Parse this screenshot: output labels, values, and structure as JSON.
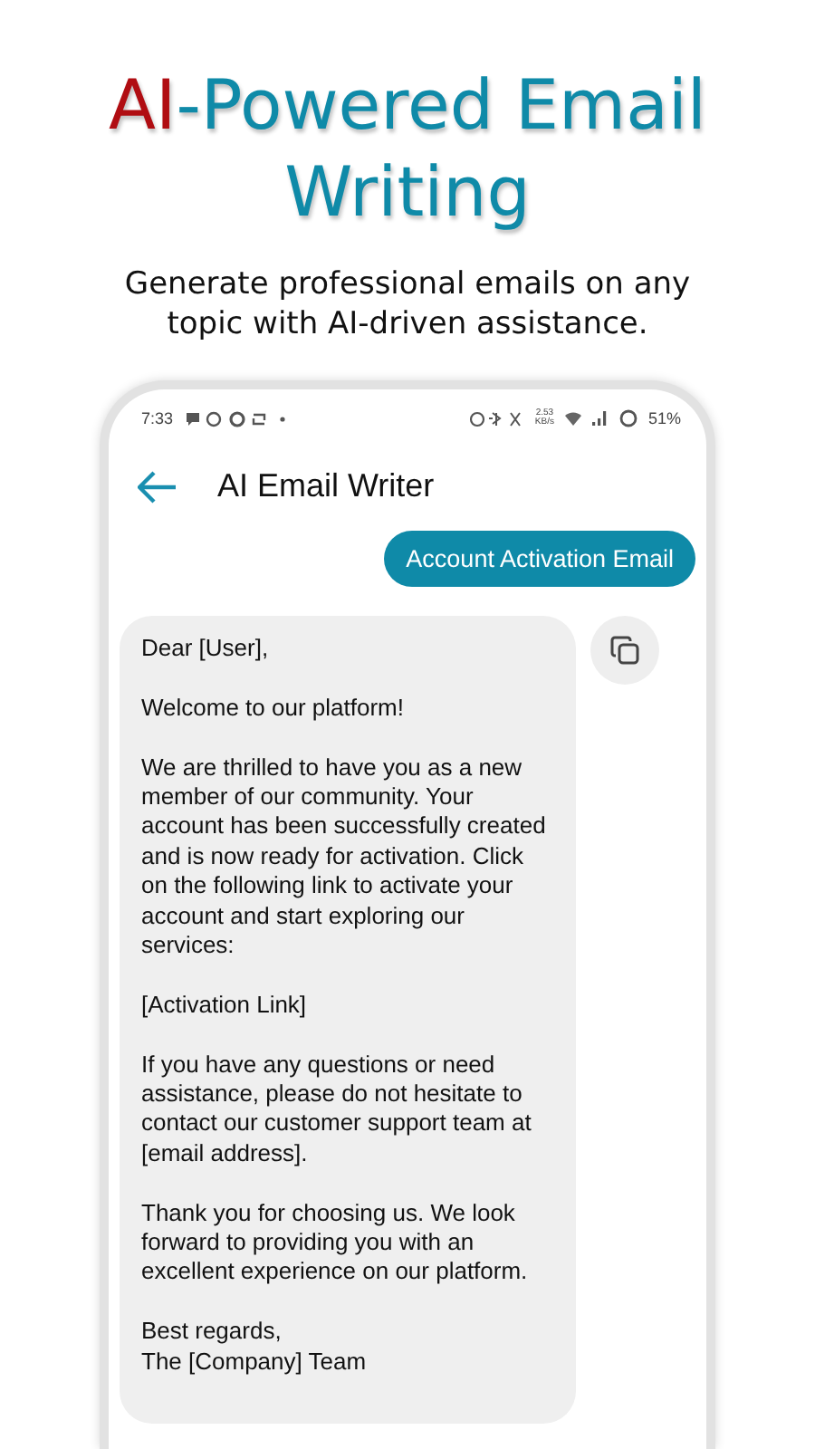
{
  "headline": {
    "accent": "AI",
    "rest": "-Powered Email Writing"
  },
  "subtitle": "Generate professional emails on any topic with AI-driven assistance.",
  "status_bar": {
    "time": "7:33",
    "speed_value": "2.53",
    "speed_unit": "KB/s",
    "battery": "51%"
  },
  "app_bar": {
    "title": "AI Email Writer"
  },
  "messages": [
    {
      "kind": "user",
      "paragraphs": [
        "Account Activation Email"
      ]
    },
    {
      "kind": "assistant",
      "paragraphs": [
        "Dear [User],",
        "Welcome to our platform!",
        "We are thrilled to have you as a new member of our community. Your account has been successfully created and is now ready for activation. Click on the following link to activate your account and start exploring our services:",
        "[Activation Link]",
        "If you have any questions or need assistance, please do not hesitate to contact our customer support team at [email address].",
        "Thank you for choosing us. We look forward to providing you with an excellent experience on our platform.",
        "Best regards,\nThe [Company] Team"
      ]
    }
  ]
}
